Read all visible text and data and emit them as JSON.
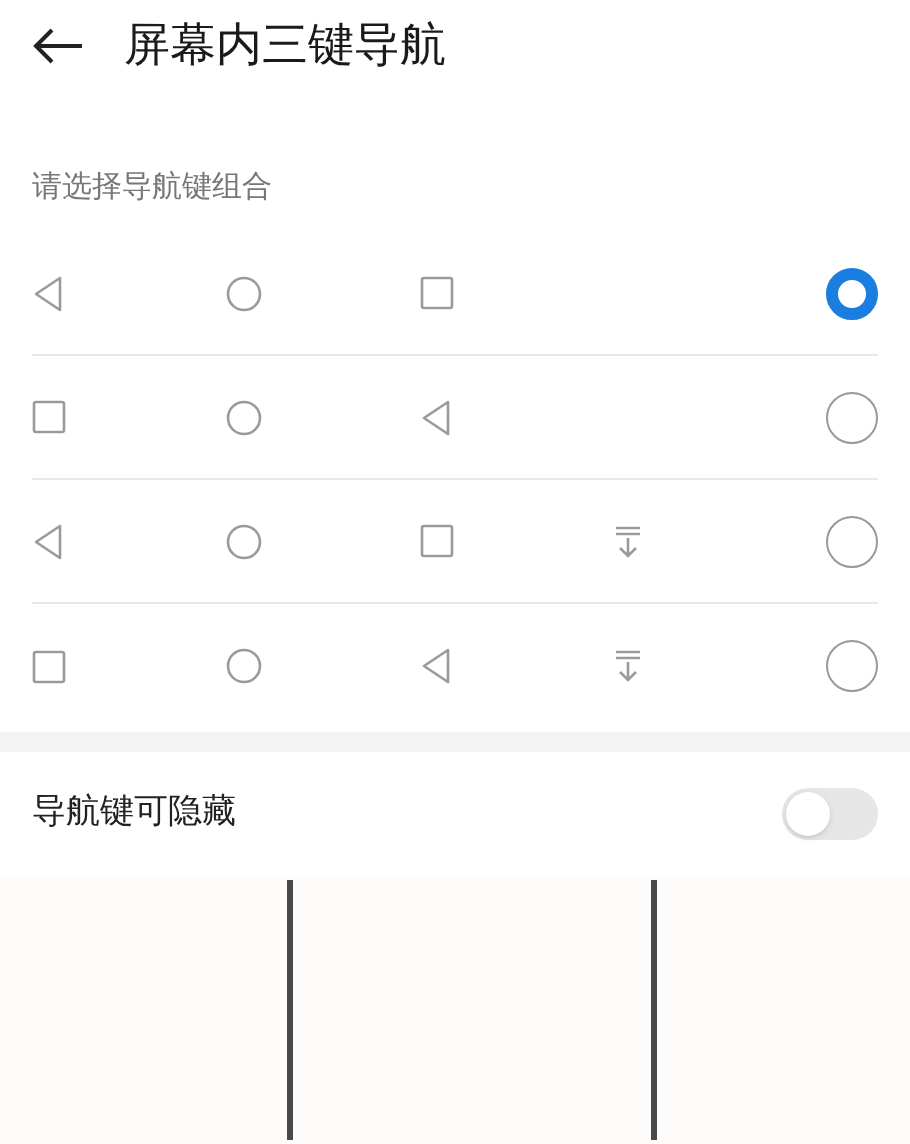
{
  "header": {
    "title": "屏幕内三键导航"
  },
  "section": {
    "title": "请选择导航键组合"
  },
  "options": [
    {
      "selected": true,
      "keys": [
        {
          "kind": "back"
        },
        {
          "kind": "home"
        },
        {
          "kind": "recent"
        }
      ]
    },
    {
      "selected": false,
      "keys": [
        {
          "kind": "recent"
        },
        {
          "kind": "home"
        },
        {
          "kind": "back"
        }
      ]
    },
    {
      "selected": false,
      "keys": [
        {
          "kind": "back"
        },
        {
          "kind": "home"
        },
        {
          "kind": "recent"
        },
        {
          "kind": "hide"
        }
      ]
    },
    {
      "selected": false,
      "keys": [
        {
          "kind": "recent"
        },
        {
          "kind": "home"
        },
        {
          "kind": "back"
        },
        {
          "kind": "hide"
        }
      ]
    }
  ],
  "hide_setting": {
    "label": "导航键可隐藏",
    "on": false
  }
}
